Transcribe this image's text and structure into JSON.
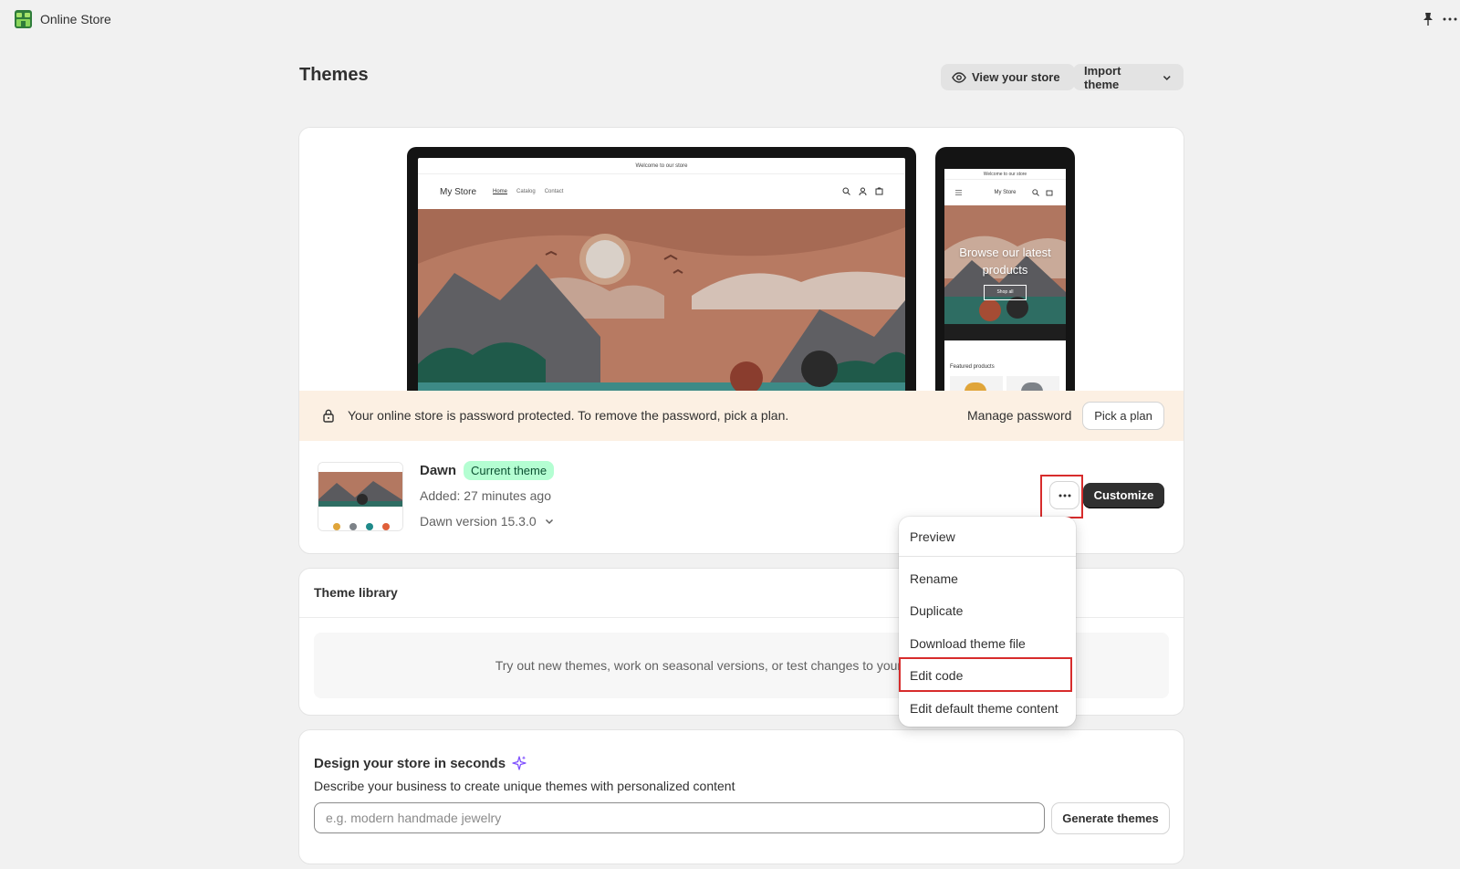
{
  "app": {
    "title": "Online Store"
  },
  "page": {
    "title": "Themes",
    "view_store_label": "View your store",
    "import_theme_label": "Import theme"
  },
  "preview": {
    "desktop": {
      "announcement": "Welcome to our store",
      "store_name": "My Store",
      "nav": [
        "Home",
        "Catalog",
        "Contact"
      ]
    },
    "mobile": {
      "announcement": "Welcome to our store",
      "store_name": "My Store",
      "hero_text": "Browse our latest products",
      "shop_button": "Shop all",
      "featured": "Featured products"
    }
  },
  "banner": {
    "message": "Your online store is password protected. To remove the password, pick a plan.",
    "manage_password": "Manage password",
    "pick_plan": "Pick a plan"
  },
  "current_theme": {
    "name": "Dawn",
    "badge": "Current theme",
    "added": "Added: 27 minutes ago",
    "version": "Dawn version 15.3.0",
    "customize_label": "Customize"
  },
  "menu": {
    "items": [
      "Preview",
      "Rename",
      "Duplicate",
      "Download theme file",
      "Edit code",
      "Edit default theme content"
    ],
    "highlighted": "Edit code"
  },
  "library": {
    "title": "Theme library",
    "empty_text": "Try out new themes, work on seasonal versions, or test changes to your current theme."
  },
  "design": {
    "title": "Design your store in seconds",
    "description": "Describe your business to create unique themes with personalized content",
    "placeholder": "e.g. modern handmade jewelry",
    "generate_label": "Generate themes"
  },
  "colors": {
    "highlight": "#d72c2c",
    "badge_bg": "#b4fed2",
    "banner_bg": "#fcf0e3",
    "primary_button": "#303030"
  }
}
